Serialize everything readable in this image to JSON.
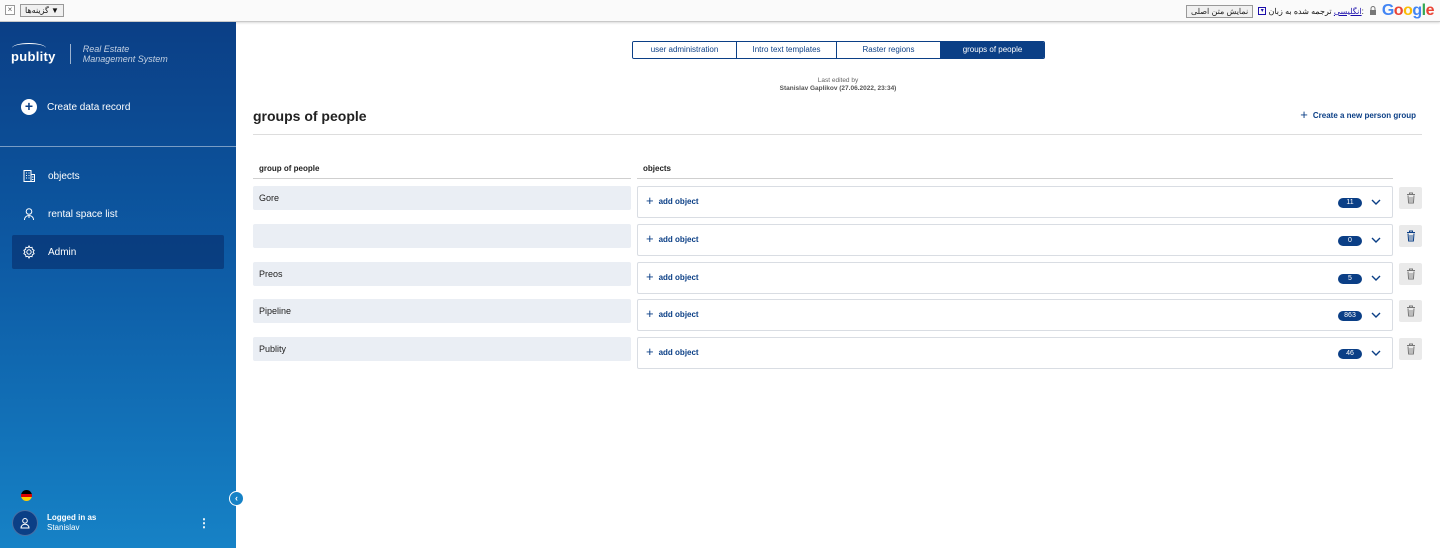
{
  "translate_bar": {
    "close_glyph": "×",
    "options_label": "گزینه‌ها ▼",
    "show_original_label": "نمایش متن اصلی",
    "translated_to_label": "ترجمه شده به زبان:",
    "language_link": "انگلیسی",
    "language_arrow": "▾",
    "google_logo": [
      "G",
      "o",
      "o",
      "g",
      "l",
      "e"
    ]
  },
  "sidebar": {
    "logo_text": "publity",
    "tagline_line1": "Real Estate",
    "tagline_line2": "Management System",
    "create_record_label": "Create data record",
    "nav_items": [
      {
        "label": "objects",
        "icon": "building-icon",
        "active": false
      },
      {
        "label": "rental space list",
        "icon": "person-key-icon",
        "active": false
      },
      {
        "label": "Admin",
        "icon": "gear-icon",
        "active": true
      }
    ],
    "language": "german-flag",
    "user_label": "Logged in as",
    "user_name": "Stanislav",
    "menu_glyph": "⋮",
    "collapse_glyph": "‹"
  },
  "tabs": [
    {
      "label": "user administration",
      "active": false
    },
    {
      "label": "Intro text templates",
      "active": false
    },
    {
      "label": "Raster regions",
      "active": false
    },
    {
      "label": "groups of people",
      "active": true
    }
  ],
  "last_edited": {
    "label": "Last edited by",
    "by": "Stanislav Gaplikov (27.06.2022, 23:34)"
  },
  "page": {
    "title": "groups of people",
    "create_button_label": "Create a new person group"
  },
  "table": {
    "columns": [
      "group of people",
      "objects"
    ],
    "add_object_label": "add object",
    "rows": [
      {
        "name": "Gore",
        "count": "11"
      },
      {
        "name": "",
        "count": "0"
      },
      {
        "name": "Preos",
        "count": "5"
      },
      {
        "name": "Pipeline",
        "count": "863"
      },
      {
        "name": "Publity",
        "count": "46"
      }
    ]
  },
  "colors": {
    "primary": "#0b3f86",
    "sidebar_bottom": "#1682c6",
    "name_field_bg": "#eaeef4"
  }
}
